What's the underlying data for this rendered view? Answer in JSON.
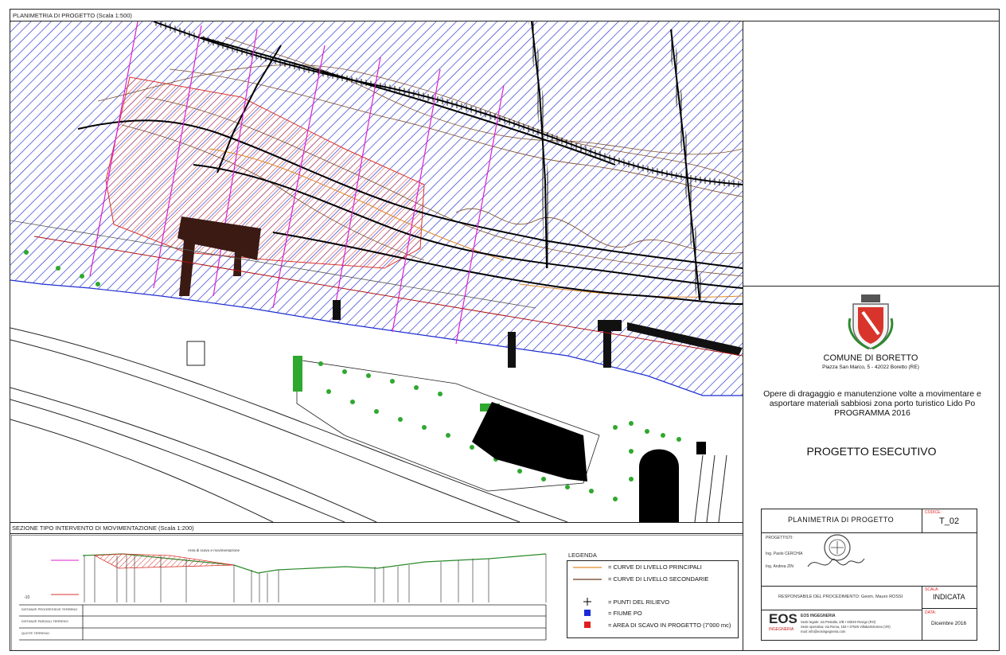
{
  "plan": {
    "header": "PLANIMETRIA DI PROGETTO (Scala 1:500)"
  },
  "section": {
    "header": "SEZIONE TIPO INTERVENTO DI MOVIMENTAZIONE (Scala 1:200)",
    "annotation": "Area di scavo e movimentazione",
    "datum": "-10",
    "rows": [
      "DISTANZE PROGRESSIVE TERRENO",
      "DISTANZE PARZIALI TERRENO",
      "QUOTE TERRENO"
    ]
  },
  "legend": {
    "title": "LEGENDA",
    "items": [
      {
        "label": "= CURVE DI LIVELLO PRINCIPALI",
        "color": "#e08a2a",
        "kind": "line"
      },
      {
        "label": "= CURVE DI LIVELLO SECONDARIE",
        "color": "#6b3b1c",
        "kind": "line"
      },
      {
        "label": "= PUNTI DEL RILIEVO",
        "color": "#000000",
        "kind": "cross"
      },
      {
        "label": "= FIUME PO",
        "color": "#1a2ad6",
        "kind": "square"
      },
      {
        "label": "= AREA DI SCAVO IN PROGETTO (7'000 mc)",
        "color": "#e02020",
        "kind": "square"
      }
    ]
  },
  "comune": {
    "name": "COMUNE DI BORETTO",
    "address": "Piazza San Marco, 5 - 42022 Boretto (RE)"
  },
  "project": {
    "description": "Opere di dragaggio e manutenzione volte a movimentare e asportare materiali sabbiosi zona porto turistico Lido Po PROGRAMMA 2016",
    "phase": "PROGETTO ESECUTIVO"
  },
  "title_block": {
    "drawing_title": "PLANIMETRIA DI PROGETTO",
    "codice_label": "CODICE:",
    "codice_value": "T_02",
    "progettisti_label": "PROGETTISTI:",
    "progettista_1": "Ing. Paolo CERCHIA",
    "progettista_2": "Ing. Andrea ZIN",
    "responsabile": "RESPONSABILE DEL PROCEDIMENTO: Geom. Mauro ROSSI",
    "scala_label": "SCALA:",
    "scala_value": "INDICATA",
    "data_label": "DATA:",
    "data_value": "Dicembre 2016",
    "firm_logo": "EOS",
    "firm_logo_sub": "INGEGNERIA",
    "firm_name": "EOS INGEGNERIA",
    "firm_line_1": "Sede legale: via Pestalla, 2/B • 45040 Rovigo (RO)",
    "firm_line_2": "Sede operativa: via Roma, 153 • 37049 Villabartolomea (VR)",
    "firm_line_3": "mail: info@eosingegneria.com",
    "stamp_text": "ORDINE DEGLI INGEGNERI"
  }
}
